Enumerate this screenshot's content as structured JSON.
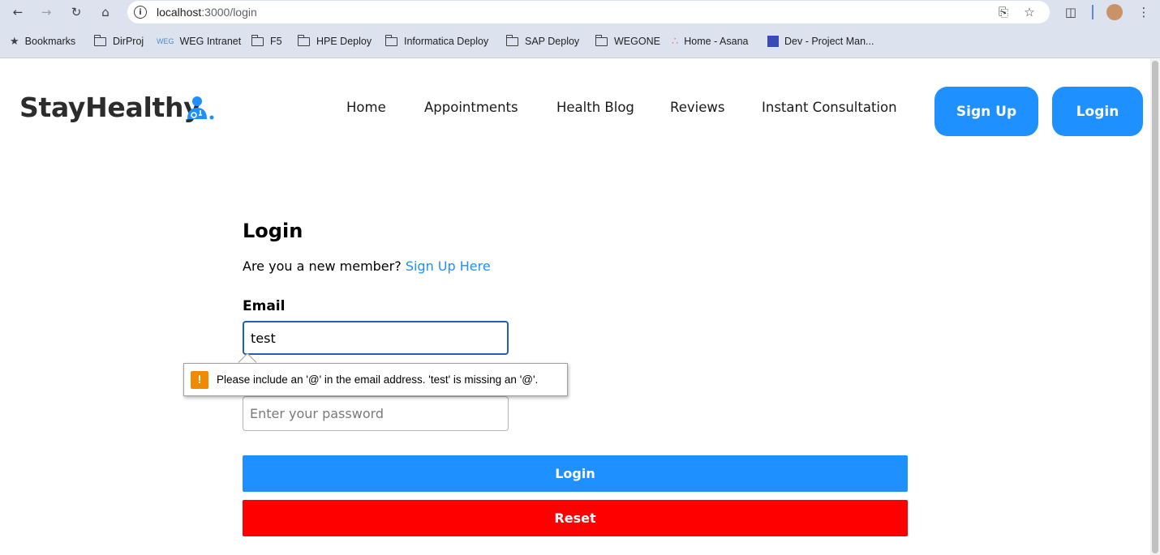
{
  "browser": {
    "url_host": "localhost",
    "url_path": ":3000/login",
    "bookmarks": [
      {
        "label": "Bookmarks",
        "icon": "star-icon"
      },
      {
        "label": "DirProj",
        "icon": "folder-icon"
      },
      {
        "label": "WEG Intranet",
        "icon": "weg-favicon"
      },
      {
        "label": "F5",
        "icon": "folder-icon"
      },
      {
        "label": "HPE Deploy",
        "icon": "folder-icon"
      },
      {
        "label": "Informatica Deploy",
        "icon": "folder-icon"
      },
      {
        "label": "SAP Deploy",
        "icon": "folder-icon"
      },
      {
        "label": "WEGONE",
        "icon": "folder-icon"
      },
      {
        "label": "Home - Asana",
        "icon": "asana-icon"
      },
      {
        "label": "Dev - Project Man...",
        "icon": "project-icon"
      }
    ]
  },
  "header": {
    "logo_text": "StayHealthy",
    "nav": [
      "Home",
      "Appointments",
      "Health Blog",
      "Reviews",
      "Instant Consultation"
    ],
    "signup_label": "Sign Up",
    "login_label": "Login",
    "accent_color": "#1e90ff"
  },
  "form": {
    "title": "Login",
    "member_prompt": "Are you a new member?",
    "signup_link": "Sign Up Here",
    "email_label": "Email",
    "email_value": "test",
    "password_placeholder": "Enter your password",
    "validation_message": "Please include an '@' in the email address. 'test' is missing an '@'.",
    "login_button": "Login",
    "reset_button": "Reset",
    "login_color": "#1e90ff",
    "reset_color": "#ff0000"
  }
}
